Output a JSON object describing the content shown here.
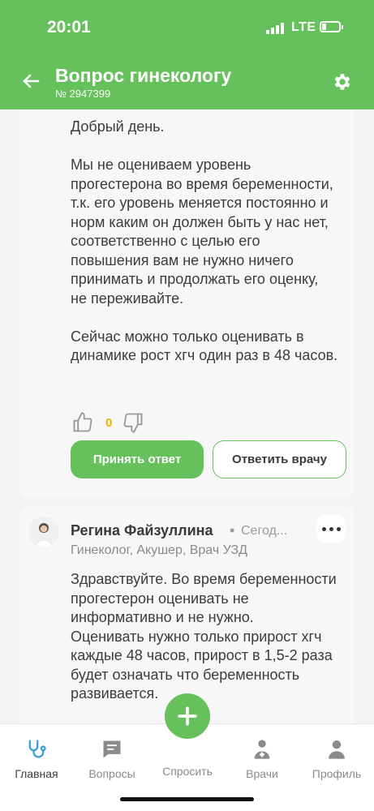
{
  "status_bar": {
    "time": "20:01",
    "network": "LTE"
  },
  "header": {
    "title": "Вопрос гинекологу",
    "question_number": "№ 2947399"
  },
  "answer1": {
    "paragraphs": [
      "Добрый день.",
      "Мы не оцениваем уровень прогестерона во время беременности, т.к. его уровень меняется постоянно и норм каким он должен быть у нас нет, соответственно с целью его повышения вам не нужно ничего принимать и продолжать его оценку, не переживайте.",
      "Сейчас можно только оценивать в динамике рост хгч один раз в 48 часов."
    ],
    "vote_count": "0",
    "accept_label": "Принять ответ",
    "reply_label": "Ответить врачу"
  },
  "answer2": {
    "doctor_name": "Регина Файзуллина",
    "separator": "•",
    "time": "Сегод...",
    "role": "Гинеколог, Акушер, Врач УЗД",
    "paragraphs": [
      "Здравствуйте. Во время беременности прогестерон оценивать не информативно и не нужно.",
      "Оценивать нужно только прирост хгч каждые 48 часов, прирост в 1,5-2 раза будет означать что беременность развивается."
    ]
  },
  "bottom_nav": {
    "items": [
      {
        "label": "Главная",
        "icon": "stethoscope-icon"
      },
      {
        "label": "Вопросы",
        "icon": "chat-icon"
      },
      {
        "label": "Спросить",
        "icon": "plus-icon"
      },
      {
        "label": "Врачи",
        "icon": "doctor-icon"
      },
      {
        "label": "Профиль",
        "icon": "person-icon"
      }
    ]
  },
  "colors": {
    "brand_green": "#66c15d",
    "vote_count": "#f0b000"
  }
}
